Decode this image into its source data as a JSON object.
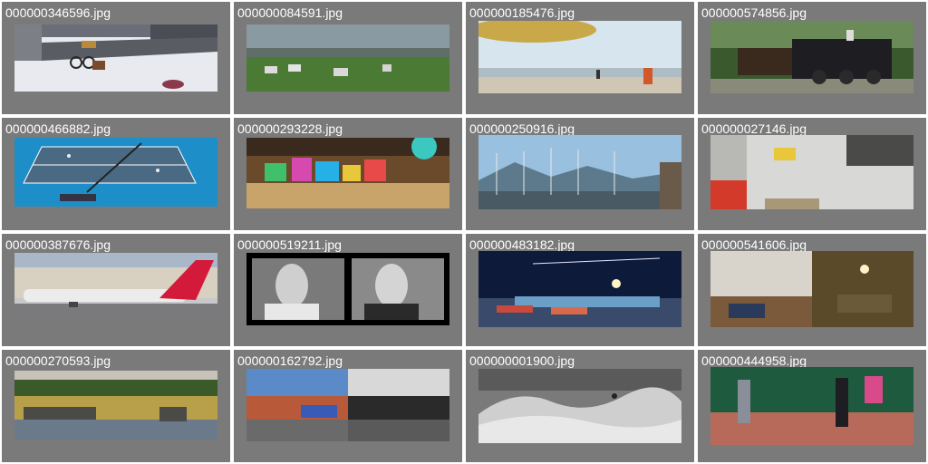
{
  "gallery": {
    "items": [
      {
        "filename": "000000346596.jpg",
        "subject": "bicycle on snowy train platform"
      },
      {
        "filename": "000000084591.jpg",
        "subject": "zebras on grassland"
      },
      {
        "filename": "000000185476.jpg",
        "subject": "person flying kite on beach"
      },
      {
        "filename": "000000574856.jpg",
        "subject": "steam locomotive"
      },
      {
        "filename": "000000466882.jpg",
        "subject": "tennis court aerial"
      },
      {
        "filename": "000000293228.jpg",
        "subject": "bookstore display"
      },
      {
        "filename": "000000250916.jpg",
        "subject": "boats in harbor"
      },
      {
        "filename": "000000027146.jpg",
        "subject": "kitchen interior"
      },
      {
        "filename": "000000387676.jpg",
        "subject": "airplane on tarmac"
      },
      {
        "filename": "000000519211.jpg",
        "subject": "black and white portraits"
      },
      {
        "filename": "000000483182.jpg",
        "subject": "airport at night"
      },
      {
        "filename": "000000541606.jpg",
        "subject": "living room interiors"
      },
      {
        "filename": "000000270593.jpg",
        "subject": "elephants by river"
      },
      {
        "filename": "000000162792.jpg",
        "subject": "train station color and bw"
      },
      {
        "filename": "000000001900.jpg",
        "subject": "ocean wave surfer"
      },
      {
        "filename": "000000444958.jpg",
        "subject": "children playing tennis"
      }
    ]
  },
  "colors": {
    "cell_bg": "#7a7a7a",
    "label": "#ffffff",
    "page_bg": "#ffffff"
  }
}
